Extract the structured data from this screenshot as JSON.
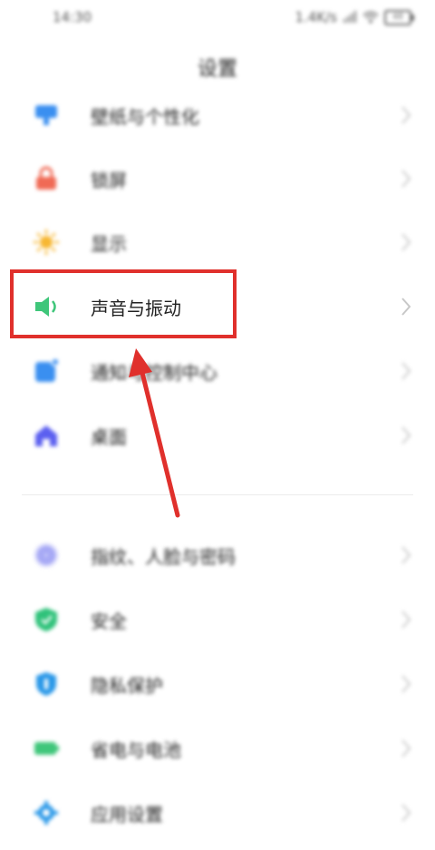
{
  "status_bar": {
    "time": "14:30",
    "net_speed": "1.4K/s",
    "battery_level": "48"
  },
  "header": {
    "title": "设置"
  },
  "settings_list": {
    "group1": [
      {
        "label": "壁纸与个性化",
        "icon": "wallpaper-icon",
        "color": "#3a8ff0"
      },
      {
        "label": "锁屏",
        "icon": "lock-icon",
        "color": "#f06a55"
      },
      {
        "label": "显示",
        "icon": "sun-icon",
        "color": "#f7b733"
      },
      {
        "label": "声音与振动",
        "icon": "speaker-icon",
        "color": "#3fc67a"
      },
      {
        "label": "通知与控制中心",
        "icon": "notification-icon",
        "color": "#3a8ff0"
      },
      {
        "label": "桌面",
        "icon": "home-icon",
        "color": "#5b5ff0"
      }
    ],
    "group2": [
      {
        "label": "指纹、人脸与密码",
        "icon": "fingerprint-icon",
        "color": "#7b7ff0"
      },
      {
        "label": "安全",
        "icon": "shield-icon",
        "color": "#2fc27a"
      },
      {
        "label": "隐私保护",
        "icon": "privacy-icon",
        "color": "#2a98e8"
      },
      {
        "label": "省电与电池",
        "icon": "battery-icon",
        "color": "#3fc67a"
      },
      {
        "label": "应用设置",
        "icon": "gear-icon",
        "color": "#2a98e8"
      }
    ]
  },
  "annotation": {
    "highlight_color": "#e0302c",
    "highlighted_item": "声音与振动"
  }
}
